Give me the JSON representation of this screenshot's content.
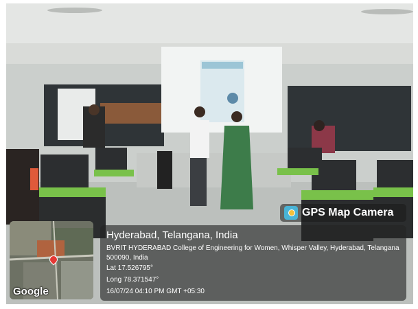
{
  "photo": {
    "description_icon": "classroom-photo",
    "colors": {
      "ceiling": "#e4e6e4",
      "wall": "#d6d8d6",
      "floor": "#bfc3c0",
      "window_dark": "#2f3437",
      "desk_green": "#79c14a",
      "screen": "#f2f4f3"
    }
  },
  "gps_badge": {
    "icon": "gps-map-camera-logo",
    "title": "GPS Map Camera"
  },
  "map_thumbnail": {
    "icon": "satellite-map",
    "pin_icon": "location-pin",
    "attribution": "Google"
  },
  "location": {
    "title": "Hyderabad, Telangana, India",
    "address": "BVRIT HYDERABAD College of Engineering for Women, Whisper Valley, Hyderabad, Telangana 500090, India",
    "lat": "Lat 17.526795°",
    "long": "Long 78.371547°",
    "timestamp": "16/07/24 04:10 PM GMT +05:30"
  }
}
